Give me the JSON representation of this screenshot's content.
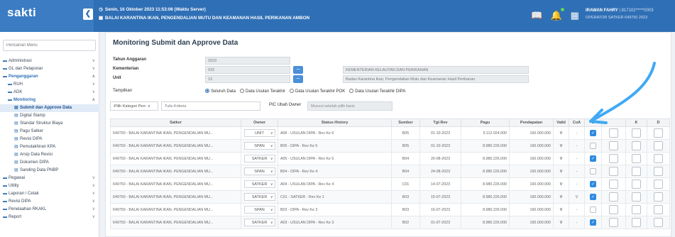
{
  "app": {
    "name": "sakti",
    "collapse_icon": "chevron-left-icon"
  },
  "header": {
    "datetime": "Senin, 16 Oktober 2023 11:53:06 (Waktu Server)",
    "office": "BALAI KARANTINA IKAN, PENGENDALIAN MUTU DAN KEAMANAN HASIL PERIKANAN AMBON",
    "user_name": "IRAWAN FAHRY",
    "user_id": "| 817102*****0003",
    "user_role": "OPERATOR SATKER 649750 2023"
  },
  "sidebar": {
    "search_placeholder": "Pencarian Menu",
    "items": [
      {
        "label": "Administrasi",
        "level": 0,
        "chev": "∨"
      },
      {
        "label": "GL dan Pelaporan",
        "level": 0,
        "chev": "∨"
      },
      {
        "label": "Penganggaran",
        "level": 0,
        "chev": "∧",
        "active": true
      },
      {
        "label": "RUH",
        "level": 1,
        "chev": "∨"
      },
      {
        "label": "ADK",
        "level": 1,
        "chev": "∨"
      },
      {
        "label": "Monitoring",
        "level": 1,
        "chev": "∧",
        "active": true
      },
      {
        "label": "Submit dan Approve Data",
        "level": 2,
        "current": true
      },
      {
        "label": "Digital Stamp",
        "level": 2
      },
      {
        "label": "Standar Struktur Biaya",
        "level": 2
      },
      {
        "label": "Pagu Satker",
        "level": 2
      },
      {
        "label": "Revisi DIPA",
        "level": 2
      },
      {
        "label": "Pemutakhiran KPA",
        "level": 2
      },
      {
        "label": "Arsip Data Revisi",
        "level": 2
      },
      {
        "label": "Dokumen DIPA",
        "level": 2
      },
      {
        "label": "Sanding Data PNBP",
        "level": 2
      },
      {
        "label": "Pegawai",
        "level": 0,
        "chev": "∨"
      },
      {
        "label": "Utility",
        "level": 0,
        "chev": "∨"
      },
      {
        "label": "Laporan / Cetak",
        "level": 0,
        "chev": "∨"
      },
      {
        "label": "Revisi DIPA",
        "level": 0,
        "chev": "∨"
      },
      {
        "label": "Penelaahan RKAKL",
        "level": 0,
        "chev": "∨"
      },
      {
        "label": "Report",
        "level": 0,
        "chev": "∨"
      }
    ]
  },
  "page": {
    "title": "Monitoring Submit dan Approve Data",
    "tahun_label": "Tahun Anggaran",
    "tahun_value": "2023",
    "kementerian_label": "Kementerian",
    "kementerian_code": "032",
    "kementerian_name": "KEMENTERIAN KELAUTAN DAN PERIKANAN",
    "unit_label": "Unit",
    "unit_code": "13",
    "unit_name": "Badan Karantina Ikan, Pengendalian Mutu dan Keamanan Hasil Perikanan",
    "tampilkan_label": "Tampilkan",
    "radio_options": [
      "Seluruh Data",
      "Data Usulan Terakhir",
      "Data Usulan Terakhir POK",
      "Data Usulan Terakhir DIPA"
    ],
    "radio_selected": 0,
    "filter_select": "-Pilih Kategori Pen-",
    "filter_placeholder": "Tulis Kriteria",
    "pic_label": "PIC Ubah Owner",
    "pic_placeholder": "Muncul setelah pilih baris"
  },
  "table": {
    "headers": [
      "Satker",
      "Owner",
      "Status-History",
      "Sumber",
      "Tgl-Rev",
      "Pagu",
      "Pendapatan",
      "Valid",
      "CoA",
      "S",
      "",
      "K",
      "D"
    ],
    "rows": [
      {
        "satker": "649750 - BALAI KARANTINA IKAN, PENGENDALIAN MU...",
        "owner": "UNIT",
        "status": "A06 - USULAN DIPA - Rev Ke 6",
        "sumber": "B05",
        "tgl": "01-10-2023",
        "pagu": "9.112.024.000",
        "pend": "160.000.000",
        "valid": "V",
        "coa": "-",
        "s": true
      },
      {
        "satker": "649750 - BALAI KARANTINA IKAN, PENGENDALIAN MU...",
        "owner": "SPAN",
        "status": "B05 - DIPA - Rev Ke 5",
        "sumber": "B05",
        "tgl": "01-10-2023",
        "pagu": "8.980.226.000",
        "pend": "160.000.000",
        "valid": "V",
        "coa": "-",
        "s": false
      },
      {
        "satker": "649750 - BALAI KARANTINA IKAN, PENGENDALIAN MU...",
        "owner": "SATKER",
        "status": "A05 - USULAN DIPA - Rev Ke 5",
        "sumber": "B04",
        "tgl": "20-08-2023",
        "pagu": "8.980.226.000",
        "pend": "160.000.000",
        "valid": "V",
        "coa": "-",
        "s": true
      },
      {
        "satker": "649750 - BALAI KARANTINA IKAN, PENGENDALIAN MU...",
        "owner": "SPAN",
        "status": "B04 - DIPA - Rev Ke 4",
        "sumber": "B04",
        "tgl": "24-08-2023",
        "pagu": "8.980.226.000",
        "pend": "160.000.000",
        "valid": "V",
        "coa": "-",
        "s": false
      },
      {
        "satker": "649750 - BALAI KARANTINA IKAN, PENGENDALIAN MU...",
        "owner": "SATKER",
        "status": "A04 - USULAN DIPA - Rev Ke 4",
        "sumber": "C01",
        "tgl": "14-07-2023",
        "pagu": "8.980.226.000",
        "pend": "160.000.000",
        "valid": "V",
        "coa": "-",
        "s": true
      },
      {
        "satker": "649750 - BALAI KARANTINA IKAN, PENGENDALIAN MU...",
        "owner": "SATKER",
        "status": "C01 - SATKER - Rev Ke 1",
        "sumber": "B03",
        "tgl": "15-07-2023",
        "pagu": "8.980.226.000",
        "pend": "160.000.000",
        "valid": "V",
        "coa": "V",
        "s": true
      },
      {
        "satker": "649750 - BALAI KARANTINA IKAN, PENGENDALIAN MU...",
        "owner": "SPAN",
        "status": "B03 - DIPA - Rev Ke 3",
        "sumber": "B03",
        "tgl": "16-07-2023",
        "pagu": "8.980.226.000",
        "pend": "160.000.000",
        "valid": "V",
        "coa": "-",
        "s": false
      },
      {
        "satker": "649750 - BALAI KARANTINA IKAN, PENGENDALIAN MU...",
        "owner": "SATKER",
        "status": "A03 - USULAN DIPA - Rev Ke 3",
        "sumber": "B02",
        "tgl": "01-07-2023",
        "pagu": "8.980.226.000",
        "pend": "160.000.000",
        "valid": "V",
        "coa": "-",
        "s": true
      }
    ]
  },
  "colors": {
    "topbar": "#2f6fb5",
    "accent": "#2f8ae0",
    "arrow": "#3fa9f5"
  }
}
